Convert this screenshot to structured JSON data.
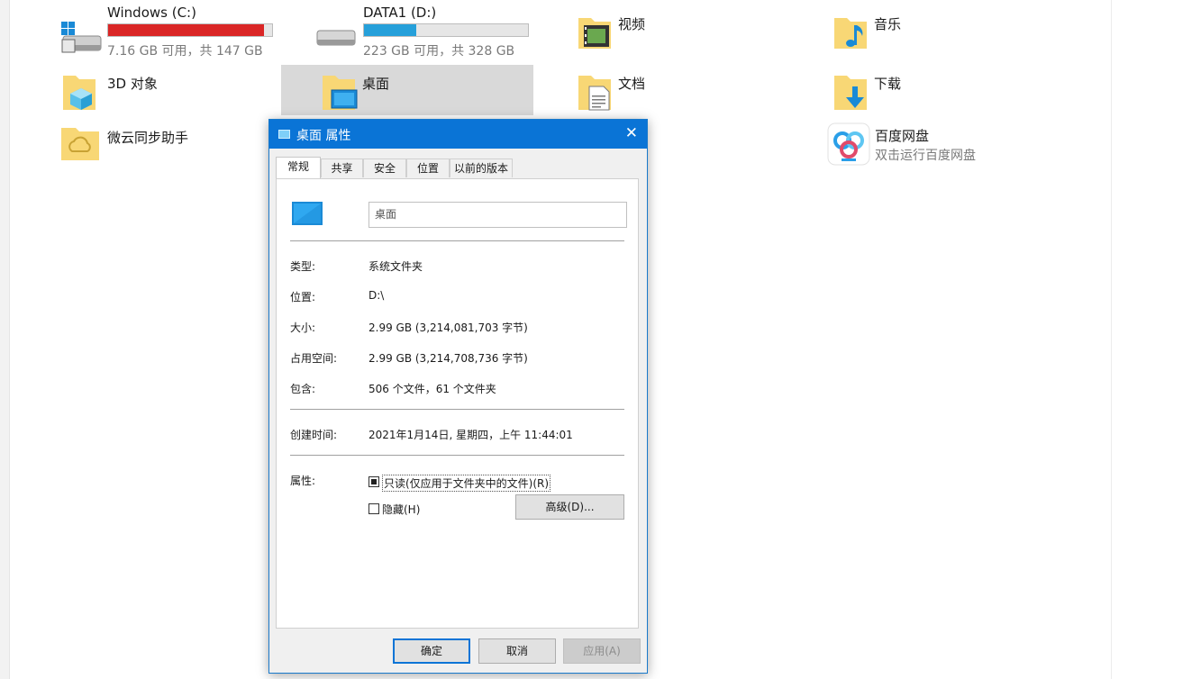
{
  "drives": [
    {
      "name": "Windows (C:)",
      "space": "7.16 GB 可用，共 147 GB",
      "used_fraction": 0.95,
      "fill_color": "#da2626",
      "icon": "windows-drive-icon"
    },
    {
      "name": "DATA1 (D:)",
      "space": "223 GB 可用，共 328 GB",
      "used_fraction": 0.32,
      "fill_color": "#26a0da",
      "icon": "hard-drive-icon"
    }
  ],
  "folders": {
    "videos": "视频",
    "music": "音乐",
    "objects3d": "3D 对象",
    "desktop": "桌面",
    "documents": "文档",
    "downloads": "下载",
    "weiyun": "微云同步助手"
  },
  "baidu": {
    "name": "百度网盘",
    "sub": "双击运行百度网盘"
  },
  "dialog": {
    "title": "桌面 属性",
    "close": "✕",
    "tabs": [
      "常规",
      "共享",
      "安全",
      "位置",
      "以前的版本"
    ],
    "name_value": "桌面",
    "rows": [
      {
        "label": "类型:",
        "value": "系统文件夹"
      },
      {
        "label": "位置:",
        "value": "D:\\"
      },
      {
        "label": "大小:",
        "value": "2.99 GB (3,214,081,703 字节)"
      },
      {
        "label": "占用空间:",
        "value": "2.99 GB (3,214,708,736 字节)"
      },
      {
        "label": "包含:",
        "value": "506 个文件，61 个文件夹"
      }
    ],
    "created_label": "创建时间:",
    "created_value": "2021年1月14日, 星期四，上午 11:44:01",
    "attr_label": "属性:",
    "readonly_label": "只读(仅应用于文件夹中的文件)(R)",
    "hidden_label": "隐藏(H)",
    "advanced_button": "高级(D)...",
    "ok_button": "确定",
    "cancel_button": "取消",
    "apply_button": "应用(A)"
  },
  "colors": {
    "accent": "#0a74d6",
    "folder": "#f8d775",
    "selection": "#d9d9d9"
  }
}
